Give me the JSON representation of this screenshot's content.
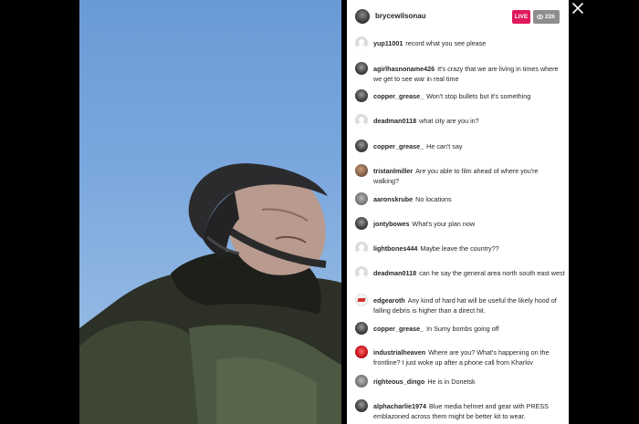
{
  "stream": {
    "host_username": "brycewilsonau",
    "live_label": "LIVE",
    "viewer_count": "226"
  },
  "comments": [
    {
      "username": "yup11001",
      "text": "record what you see please",
      "avatar": "default"
    },
    {
      "username": "agirlhasnoname426",
      "text": "It's crazy that we are living in times where we get to see war in real time",
      "avatar": "dark"
    },
    {
      "username": "copper_grease_",
      "text": "Won't stop bullets but it's something",
      "avatar": "dark"
    },
    {
      "username": "deadman0118",
      "text": "what city are you in?",
      "avatar": "default"
    },
    {
      "username": "copper_grease_",
      "text": "He can't say",
      "avatar": "dark"
    },
    {
      "username": "tristanlmiller",
      "text": "Are you able to film ahead of where you're walking?",
      "avatar": "brown"
    },
    {
      "username": "aaronskrube",
      "text": "No locations",
      "avatar": "gray"
    },
    {
      "username": "jontybowes",
      "text": "What's your plan now",
      "avatar": "dark"
    },
    {
      "username": "lightbones444",
      "text": "Maybe leave the country??",
      "avatar": "default"
    },
    {
      "username": "deadman0118",
      "text": "can he say the general area north south east west",
      "avatar": "default"
    },
    {
      "username": "edgearoth",
      "text": "Any kind of hard hat will be useful the likely hood of falling debris is higher than a direct hit.",
      "avatar": "logo"
    },
    {
      "username": "copper_grease_",
      "text": "In Sumy bombs going off",
      "avatar": "dark"
    },
    {
      "username": "industrialheaven",
      "text": "Where are you? What's happening on the frontline? I just woke up after a phone call from Kharkiv",
      "avatar": "red"
    },
    {
      "username": "righteous_dingo",
      "text": "He is in Donetsk",
      "avatar": "gray"
    },
    {
      "username": "alphacharlie1974",
      "text": "Blue media helmet and gear with PRESS emblazoned across them might be better kit to wear.",
      "avatar": "dark"
    }
  ]
}
